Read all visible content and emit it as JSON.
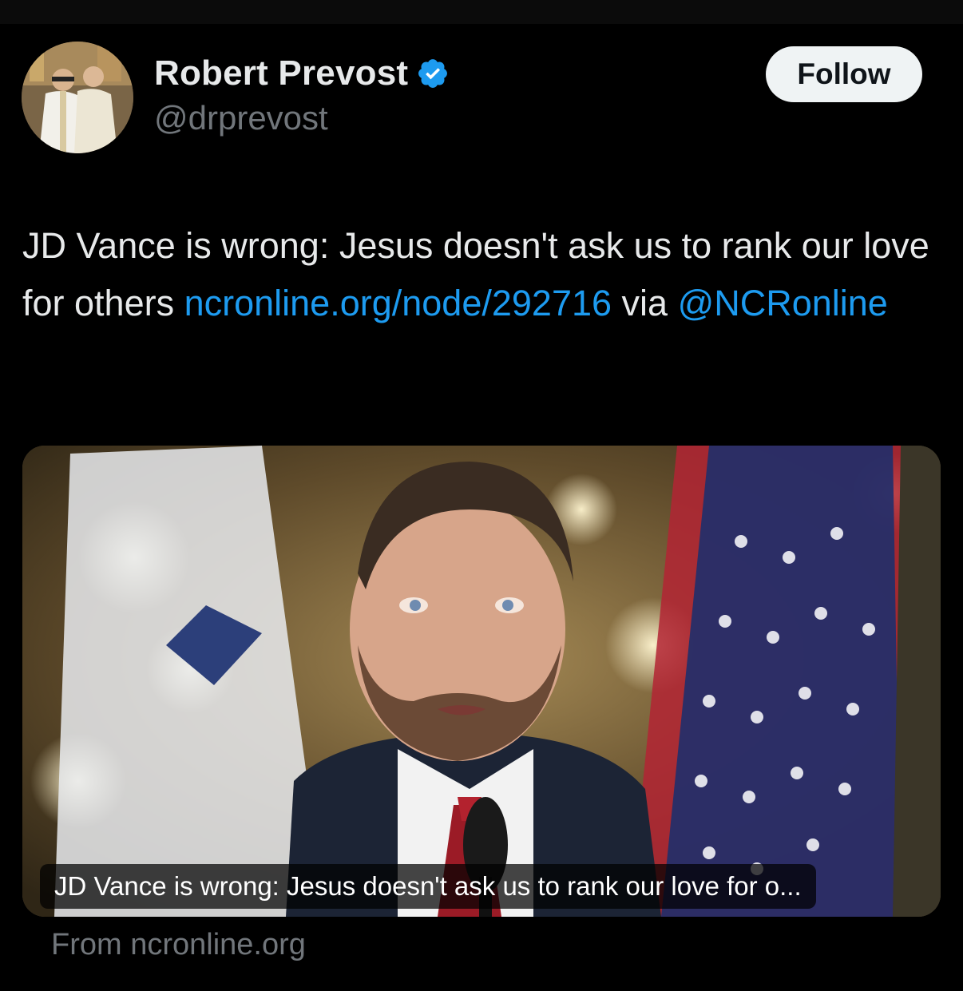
{
  "tweet": {
    "author": {
      "display_name": "Robert Prevost",
      "handle": "@drprevost",
      "verified": true,
      "verified_icon": "verified-badge-icon",
      "avatar_icon": "avatar-photo"
    },
    "follow_label": "Follow",
    "text": {
      "line_part1": "JD Vance is wrong: Jesus doesn't ask us to rank our love for others ",
      "link": "ncronline.org/node/292716",
      "via_prefix": " via ",
      "mention": "@NCRonline"
    },
    "card": {
      "title": "JD Vance is wrong: Jesus doesn't ask us to rank our love for o...",
      "source": "From ncronline.org"
    }
  },
  "colors": {
    "background": "#000000",
    "text_primary": "#e7e9ea",
    "text_secondary": "#71767b",
    "link": "#1d9bf0",
    "button_bg": "#eff3f4",
    "button_text": "#0f1419"
  }
}
